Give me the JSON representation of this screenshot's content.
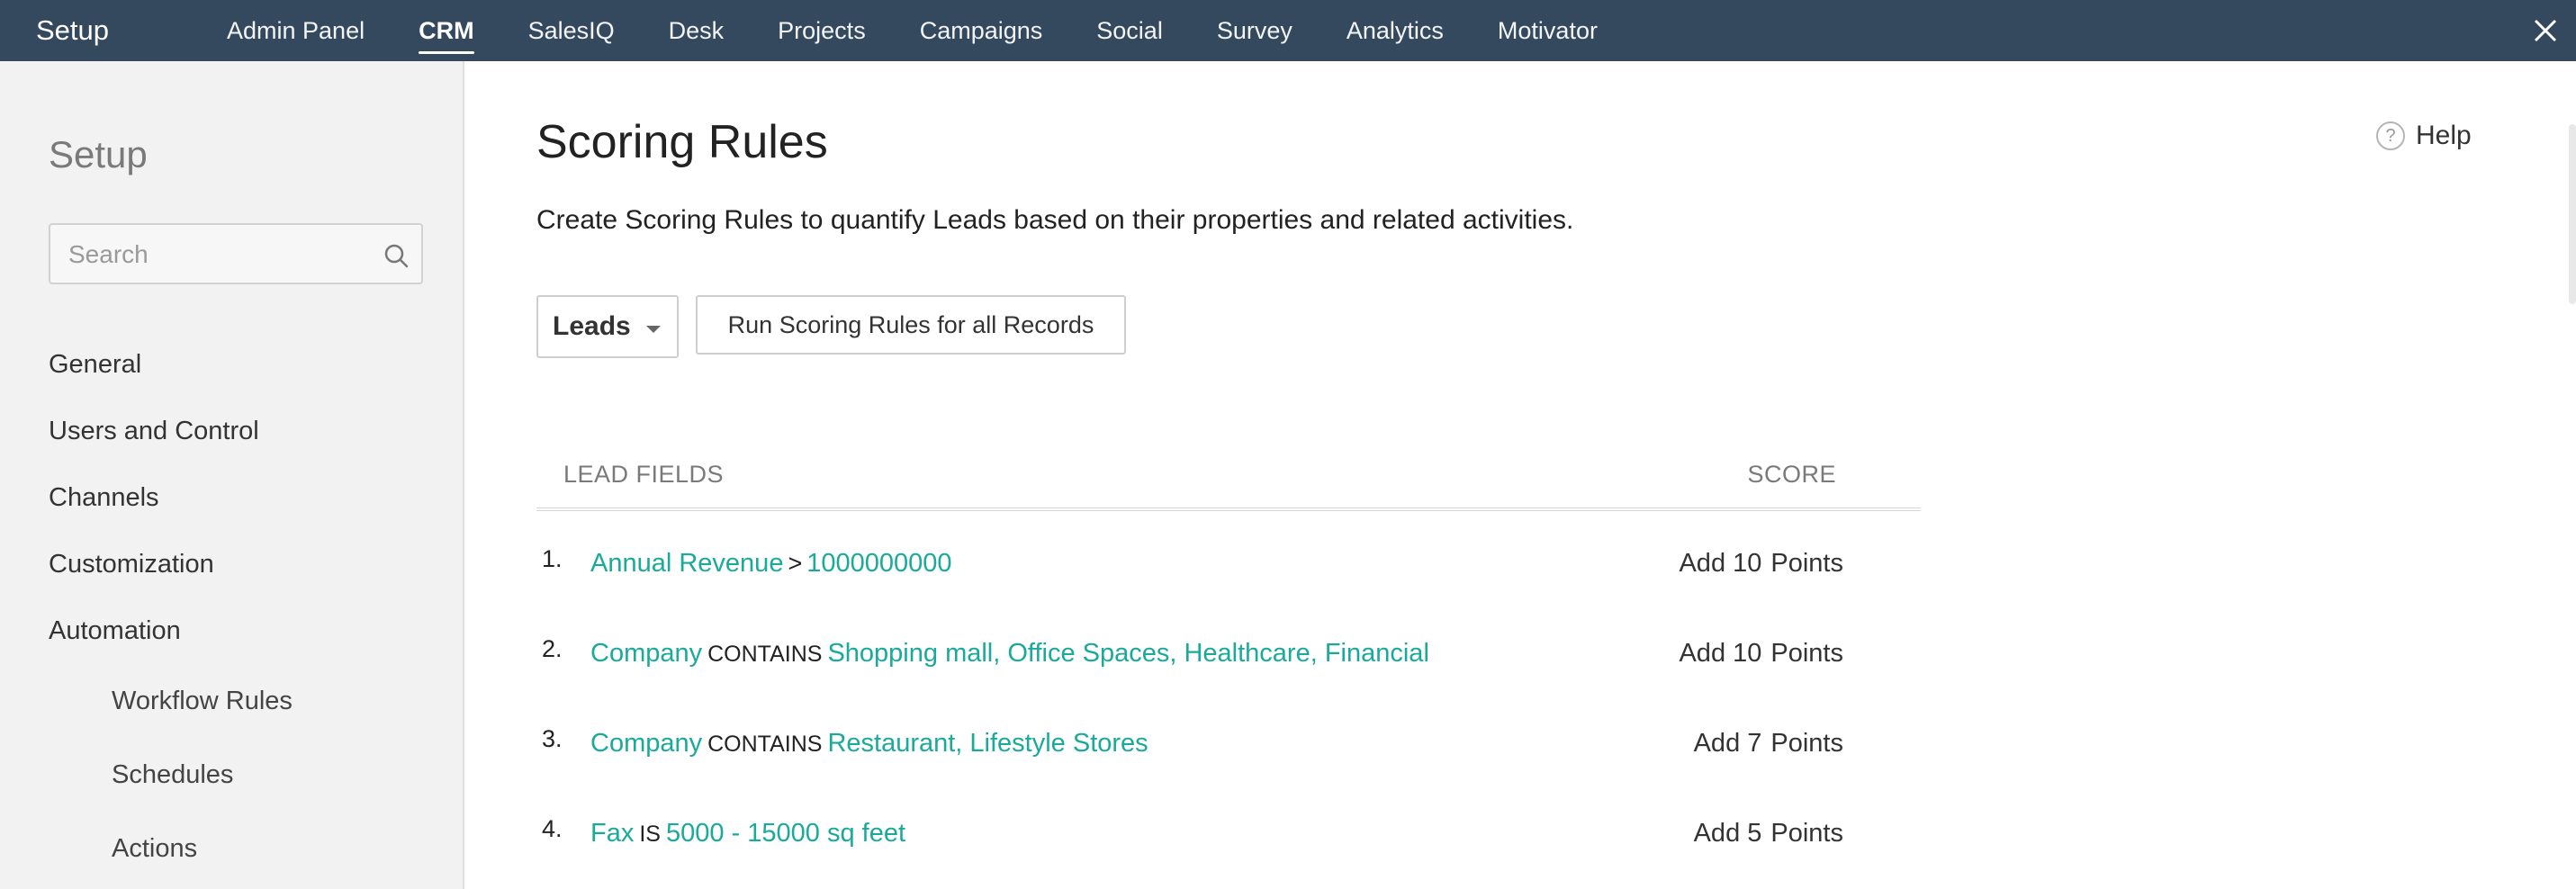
{
  "topbar": {
    "brand": "Setup",
    "nav": [
      "Admin Panel",
      "CRM",
      "SalesIQ",
      "Desk",
      "Projects",
      "Campaigns",
      "Social",
      "Survey",
      "Analytics",
      "Motivator"
    ],
    "active": "CRM",
    "close_icon": "close-icon"
  },
  "sidebar": {
    "title": "Setup",
    "search_placeholder": "Search",
    "search_value": "",
    "items": [
      "General",
      "Users and Control",
      "Channels",
      "Customization",
      "Automation"
    ],
    "subitems": [
      "Workflow Rules",
      "Schedules",
      "Actions"
    ]
  },
  "main": {
    "title": "Scoring Rules",
    "help_label": "Help",
    "description": "Create Scoring Rules to quantify Leads based on their properties and related activities.",
    "module_select": "Leads",
    "run_button": "Run Scoring Rules for all Records",
    "table": {
      "col_fields": "LEAD FIELDS",
      "col_score": "SCORE",
      "rows": [
        {
          "index": "1.",
          "field": "Annual Revenue",
          "operator": ">",
          "value": "1000000000",
          "score": "Add 10",
          "unit": "Points"
        },
        {
          "index": "2.",
          "field": "Company",
          "operator": "CONTAINS",
          "value": "Shopping mall, Office Spaces, Healthcare, Financial",
          "score": "Add 10",
          "unit": "Points"
        },
        {
          "index": "3.",
          "field": "Company",
          "operator": "CONTAINS",
          "value": "Restaurant, Lifestyle Stores",
          "score": "Add 7",
          "unit": "Points"
        },
        {
          "index": "4.",
          "field": "Fax",
          "operator": "IS",
          "value": "5000 - 15000 sq feet",
          "score": "Add 5",
          "unit": "Points"
        }
      ]
    }
  },
  "colors": {
    "topbar_bg": "#34495e",
    "link": "#1aaa9a",
    "sidebar_bg": "#f2f2f2"
  }
}
